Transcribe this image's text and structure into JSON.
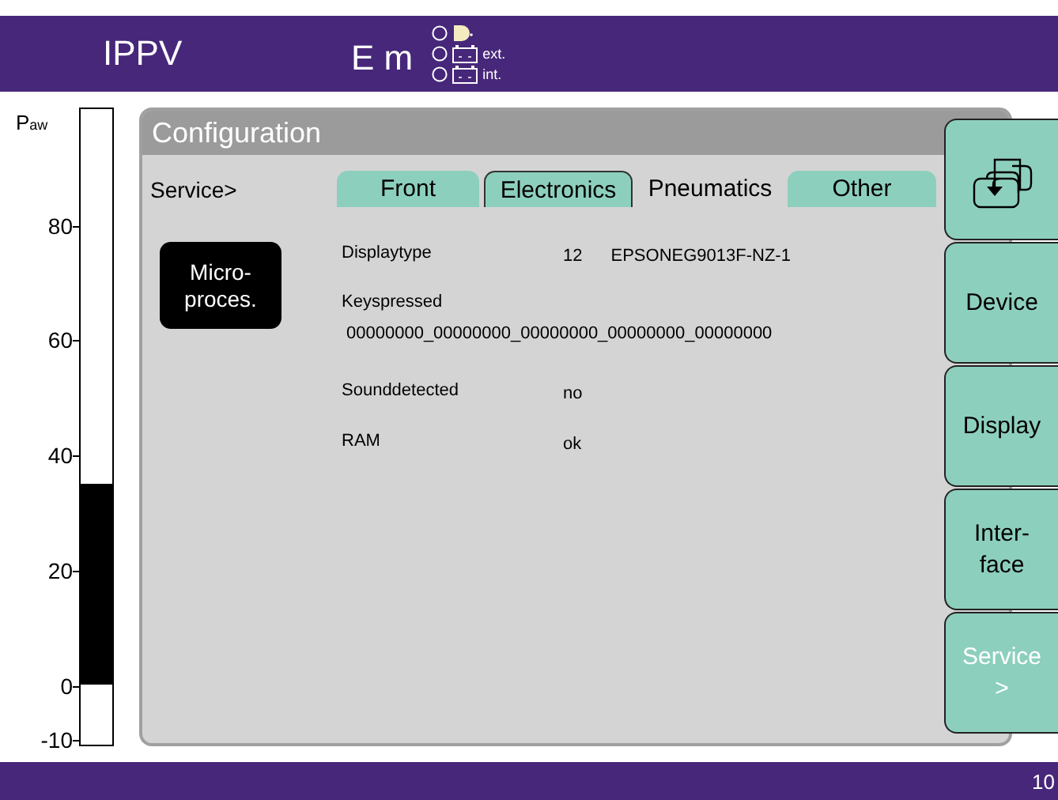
{
  "header": {
    "title": "IPPV",
    "mode": "E m",
    "indicators": [
      {
        "kind": "lamp"
      },
      {
        "kind": "battery",
        "label": "ext."
      },
      {
        "kind": "battery",
        "label": "int."
      }
    ]
  },
  "gauge": {
    "label": "P$_{aw}$",
    "ticks": [
      "80",
      "60",
      "40",
      "20",
      "0",
      "-10"
    ]
  },
  "panel": {
    "title": "Configuration",
    "breadcrumb": "Service>",
    "tabs": [
      {
        "label": "Front",
        "selected": false,
        "focused": false
      },
      {
        "label": "Electronics",
        "selected": false,
        "focused": true
      },
      {
        "label": "Pneumatics",
        "selected": true,
        "focused": false
      },
      {
        "label": "Other",
        "selected": false,
        "focused": false
      }
    ],
    "device_button": "Micro-proces.",
    "rows": [
      {
        "kind": "inline",
        "label": "Displaytype",
        "value": "12",
        "detail": "EPSONEG9013F-NZ-1"
      },
      {
        "kind": "below",
        "label": "Keyspressed",
        "value": "00000000_00000000_00000000_00000000_00000000"
      },
      {
        "kind": "inline",
        "label": "Sounddetected",
        "value": "no"
      },
      {
        "kind": "inline",
        "label": "RAM",
        "value": "ok"
      }
    ]
  },
  "sidebar": [
    {
      "kind": "icon",
      "selected": false
    },
    {
      "kind": "text",
      "label": "Device",
      "selected": false
    },
    {
      "kind": "text",
      "label": "Display",
      "selected": false
    },
    {
      "kind": "text",
      "label": "Inter-face",
      "selected": false
    },
    {
      "kind": "text",
      "label": "Service >",
      "selected": true
    }
  ],
  "footer": {
    "page": "10"
  }
}
